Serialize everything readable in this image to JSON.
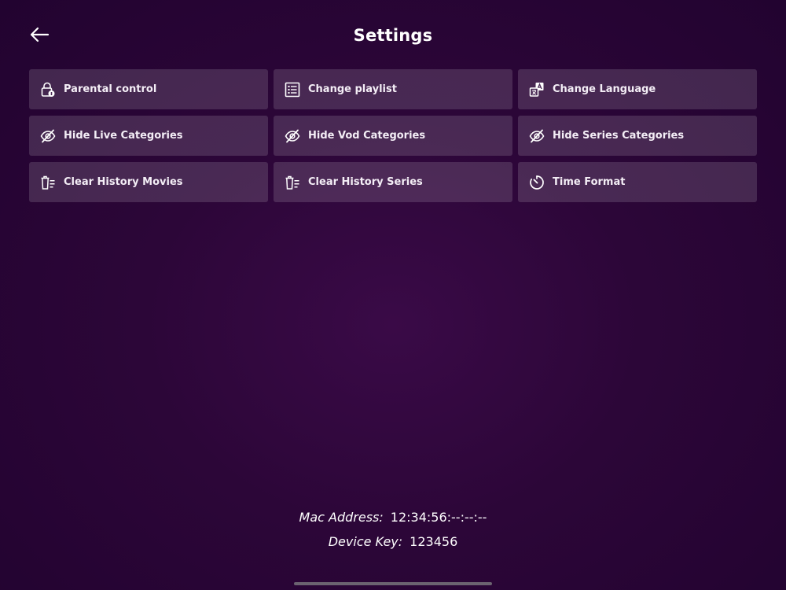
{
  "header": {
    "title": "Settings"
  },
  "tiles": [
    {
      "id": "parental-control",
      "label": "Parental control",
      "icon": "lock-icon"
    },
    {
      "id": "change-playlist",
      "label": "Change playlist",
      "icon": "list-icon"
    },
    {
      "id": "change-language",
      "label": "Change Language",
      "icon": "translate-icon"
    },
    {
      "id": "hide-live-categories",
      "label": "Hide Live Categories",
      "icon": "eye-off-icon"
    },
    {
      "id": "hide-vod-categories",
      "label": "Hide Vod Categories",
      "icon": "eye-off-icon"
    },
    {
      "id": "hide-series-categories",
      "label": "Hide Series Categories",
      "icon": "eye-off-icon"
    },
    {
      "id": "clear-history-movies",
      "label": "Clear History Movies",
      "icon": "clear-history-icon"
    },
    {
      "id": "clear-history-series",
      "label": "Clear History Series",
      "icon": "clear-history-icon"
    },
    {
      "id": "time-format",
      "label": "Time Format",
      "icon": "timer-icon"
    }
  ],
  "device": {
    "mac_label": "Mac Address:",
    "mac_value": "12:34:56:--:--:--",
    "key_label": "Device Key:",
    "key_value": "123456"
  },
  "colors": {
    "background": "#2c0638",
    "tile": "#4a2a55",
    "text": "#ffffff"
  }
}
